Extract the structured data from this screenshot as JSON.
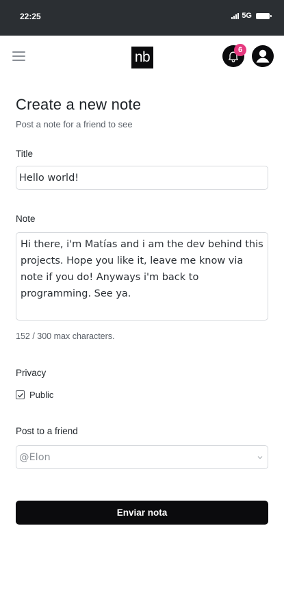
{
  "status_bar": {
    "time": "22:25",
    "network": "5G",
    "icons": [
      "signal-icon",
      "battery-icon"
    ]
  },
  "header": {
    "menu_icon": "hamburger-menu-icon",
    "logo_text": "nb",
    "notification_icon": "bell-icon",
    "notification_count": "6",
    "avatar_icon": "user-icon",
    "badge_color": "#e6397f"
  },
  "page": {
    "title": "Create a new note",
    "subtitle": "Post a note for a friend to see"
  },
  "form": {
    "title_label": "Title",
    "title_value": "Hello world!",
    "note_label": "Note",
    "note_value": "Hi there, i'm Matías and i am the dev behind this projects. Hope you like it, leave me know via note if you do! Anyways i'm back to programming. See ya.",
    "char_count": "152 / 300 max characters.",
    "privacy_label": "Privacy",
    "public_label": "Public",
    "public_checked": true,
    "friend_label": "Post to a friend",
    "friend_placeholder": "@Elon",
    "submit_label": "Enviar nota"
  }
}
